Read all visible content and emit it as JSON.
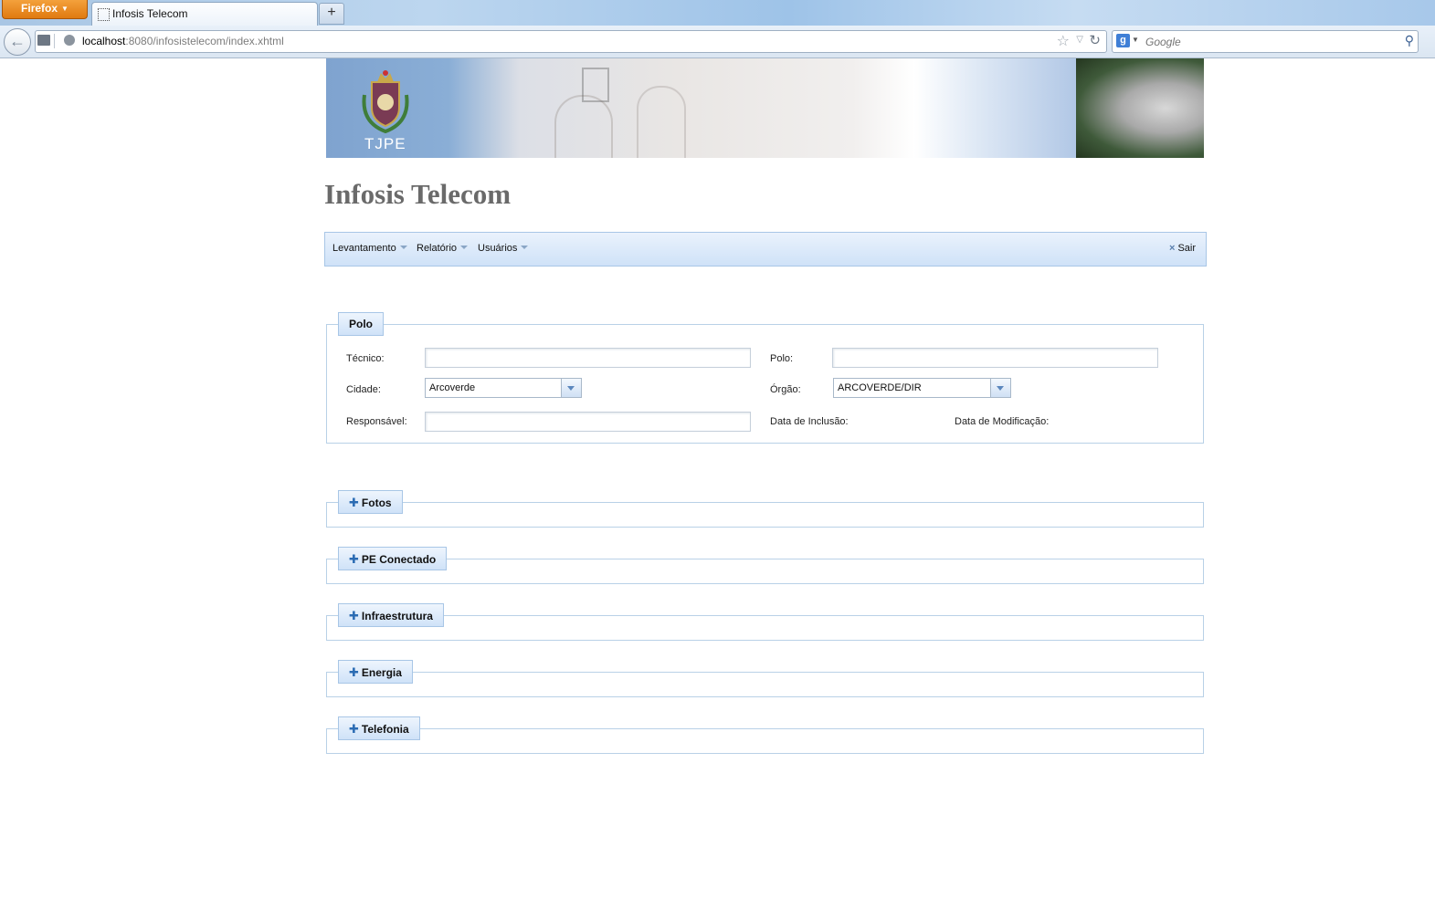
{
  "browser": {
    "menu_button": "Firefox",
    "tab_title": "Infosis Telecom",
    "new_tab_symbol": "+",
    "url_host": "localhost",
    "url_rest": ":8080/infosistelecom/index.xhtml",
    "search_placeholder": "Google",
    "search_engine_letter": "g"
  },
  "banner": {
    "caption": "TJPE"
  },
  "app": {
    "title": "Infosis Telecom"
  },
  "menu": {
    "items": [
      "Levantamento",
      "Relatório",
      "Usuários"
    ],
    "logout": "Sair"
  },
  "polo_section": {
    "legend": "Polo",
    "tecnico_label": "Técnico:",
    "tecnico_value": "",
    "polo_label": "Polo:",
    "polo_value": "",
    "cidade_label": "Cidade:",
    "cidade_value": "Arcoverde",
    "orgao_label": "Órgão:",
    "orgao_value": "ARCOVERDE/DIR",
    "responsavel_label": "Responsável:",
    "responsavel_value": "",
    "data_inclusao_label": "Data de Inclusão:",
    "data_modificacao_label": "Data de Modificação:"
  },
  "collapsed_sections": [
    "Fotos",
    "PE Conectado",
    "Infraestrutura",
    "Energia",
    "Telefonia"
  ],
  "colors": {
    "menubar_top": "#eaf2fc",
    "menubar_bottom": "#cfe2f8",
    "border": "#b9d1e7",
    "title_gray": "#6a6a6a",
    "firefox_orange": "#e07a10"
  }
}
